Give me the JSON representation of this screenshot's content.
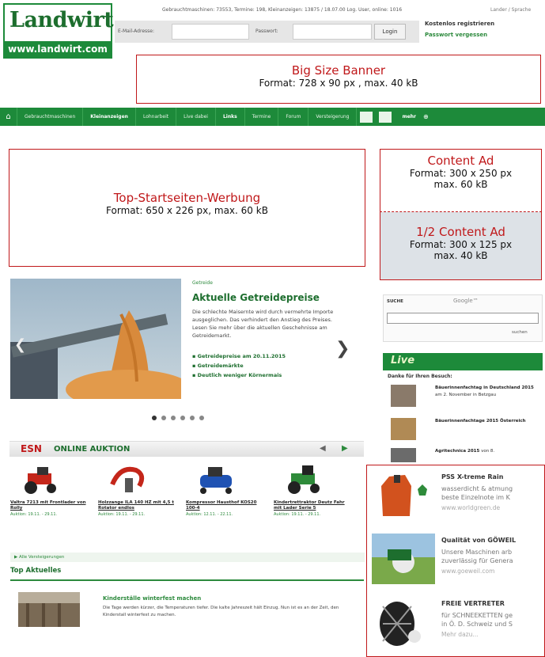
{
  "header": {
    "logo_top": "Landwirt",
    "logo_bottom": "www.landwirt.com",
    "stats_line": "Gebrauchtmaschinen: 73553, Termine: 198, Kleinanzeigen: 13875 / 18.07.00 Log. User, online: 1016",
    "language": "Lander / Sprache",
    "email_label": "E-Mail-Adresse:",
    "password_label": "Passwort:",
    "login_button": "Login",
    "register_link": "Kostenlos registrieren",
    "forgot_link": "Passwort vergessen"
  },
  "big_banner": {
    "title": "Big Size Banner",
    "format": "Format: 728 x 90 px , max. 40 kB"
  },
  "nav": {
    "items": [
      "Gebrauchtmaschinen",
      "Kleinanzeigen",
      "Lohnarbeit",
      "Live dabei",
      "Links",
      "Termine",
      "Forum",
      "Versteigerung"
    ],
    "more": "mehr"
  },
  "top_ad": {
    "title": "Top-Startseiten-Werbung",
    "format": "Format: 650 x 226 px, max. 60 kB"
  },
  "content_ad": {
    "title": "Content Ad",
    "format1": "Format: 300 x 250 px",
    "format2": "max. 60 kB"
  },
  "half_ad": {
    "title": "1/2 Content Ad",
    "format1": "Format: 300 x 125 px",
    "format2": "max. 40 kB"
  },
  "slider": {
    "category": "Getreide",
    "title": "Aktuelle Getreidepreise",
    "text": "Die schlechte Maisernte wird durch vermehrte Importe ausgeglichen. Das verhindert den Anstieg des Preises. Lesen Sie mehr über die aktuellen Geschehnisse am Getreidemarkt.",
    "links": [
      "Getreidepreise am 20.11.2015",
      "Getreidemärkte",
      "Deutlich weniger Körnermais"
    ]
  },
  "auction": {
    "logo": "ESN",
    "title": "ONLINE AUKTION",
    "items": [
      {
        "title": "Valtra 7213 mit Frontlader von Rolly",
        "date": "Auktion: 19.11. - 29.11."
      },
      {
        "title": "Holzzange ILA 140 HZ mit 4,5 t Rotator endlos",
        "date": "Auktion: 19.11. - 29.11."
      },
      {
        "title": "Kompressor Hausthof KOS20 100-4",
        "date": "Auktion: 12.11. - 22.11."
      },
      {
        "title": "Kindertrettraktor Deutz Fahr mit Lader Serie 5",
        "date": "Auktion: 19.11. - 29.11."
      }
    ],
    "all_link": "Alle Versteigerungen"
  },
  "top_news": {
    "heading": "Top Aktuelles",
    "title": "Kinderställe winterfest machen",
    "text": "Die Tage werden kürzer, die Temperaturen tiefer. Die kalte Jahreszeit hält Einzug. Nun ist es an der Zeit, den Kinderstall winterfest zu machen."
  },
  "search": {
    "label": "SUCHE",
    "provider": "Google™",
    "button": "suchen"
  },
  "live": {
    "header": "Live",
    "subtitle": "Danke für Ihren Besuch:",
    "items": [
      {
        "bold": "Bäuerinnenfachtag in Deutschland 2015",
        "text": " am 2. November in Betzgau"
      },
      {
        "bold": "Bäuerinnenfachtage 2015 Österreich",
        "text": ""
      },
      {
        "bold": "Agritechnica 2015",
        "text": " von 8."
      }
    ]
  },
  "sponsored": [
    {
      "title": "PSS X-treme Rain",
      "line1": "wasserdicht & atmung",
      "line2": "beste Einzelnote im K",
      "url": "www.worldgreen.de"
    },
    {
      "title": "Qualität von GÖWEIL",
      "line1": "Unsere Maschinen arb",
      "line2": "zuverlässig für Genera",
      "url": "www.goeweil.com"
    },
    {
      "title": "FREIE VERTRETER",
      "line1": "für SCHNEEKETTEN ge",
      "line2": "in Ö. D. Schweiz und S",
      "url": "Mehr dazu..."
    }
  ],
  "colors": {
    "brand_green": "#1d8a3a",
    "ad_red": "#c0181a"
  }
}
